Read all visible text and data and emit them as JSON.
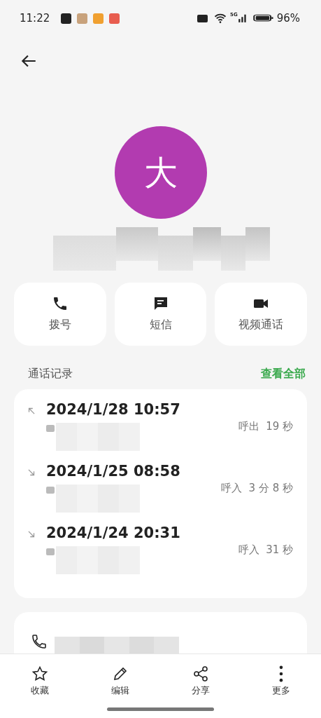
{
  "status_bar": {
    "time": "11:22",
    "battery": "96%",
    "network": "5G"
  },
  "contact": {
    "avatar_letter": "大"
  },
  "actions": [
    {
      "kind": "call",
      "label": "拨号"
    },
    {
      "kind": "message",
      "label": "短信"
    },
    {
      "kind": "video",
      "label": "视频通话"
    }
  ],
  "call_log": {
    "title": "通话记录",
    "view_all": "查看全部",
    "entries": [
      {
        "kind": "outgoing",
        "time": "2024/1/28 10:57",
        "summary": "呼出  19 秒"
      },
      {
        "kind": "incoming",
        "time": "2024/1/25 08:58",
        "summary": "呼入  3 分 8 秒"
      },
      {
        "kind": "incoming",
        "time": "2024/1/24 20:31",
        "summary": "呼入  31 秒"
      }
    ]
  },
  "bottom_bar": [
    {
      "kind": "star",
      "label": "收藏"
    },
    {
      "kind": "edit",
      "label": "编辑"
    },
    {
      "kind": "share",
      "label": "分享"
    },
    {
      "kind": "more",
      "label": "更多"
    }
  ]
}
